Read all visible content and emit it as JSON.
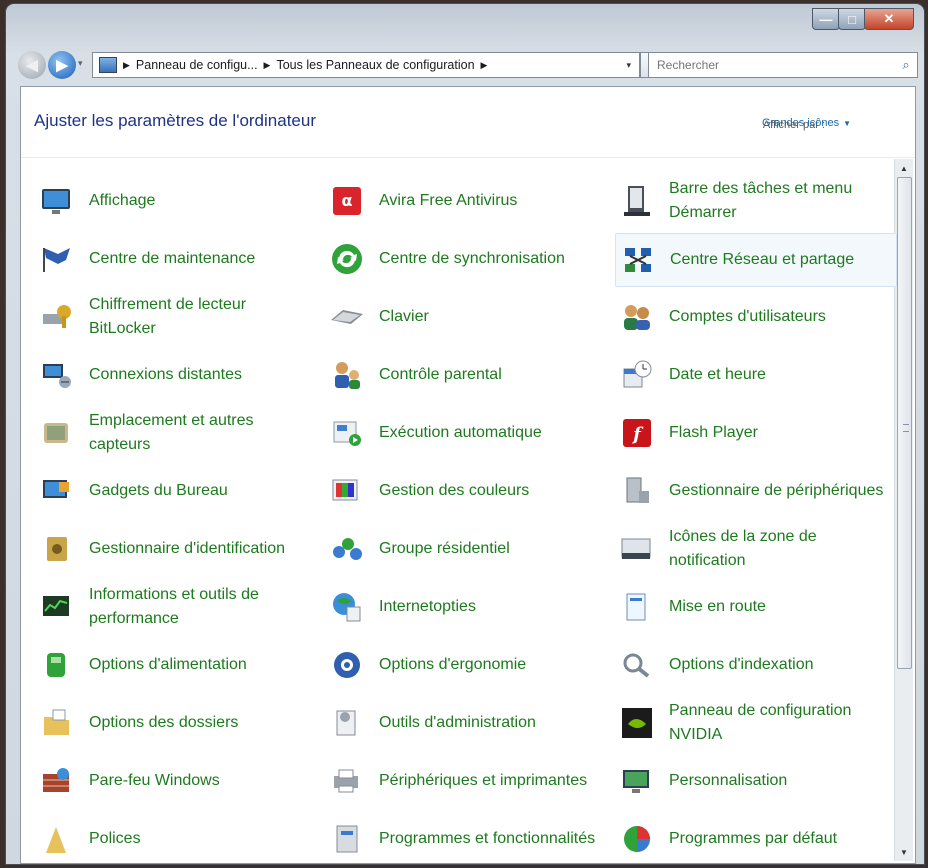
{
  "window": {
    "min_label": "—",
    "max_label": "□",
    "close_label": "✕"
  },
  "nav": {
    "back_glyph": "◀",
    "forward_glyph": "▶",
    "history_glyph": "▾",
    "breadcrumb": [
      "Panneau de configu...",
      "Tous les Panneaux de configuration"
    ],
    "breadcrumb_sep": "▶",
    "dropdown_glyph": "▾",
    "refresh_glyph": "↻",
    "search_placeholder": "Rechercher",
    "search_glyph": "⌕"
  },
  "header": {
    "title": "Ajuster les paramètres de l'ordinateur",
    "view_by_label": "Afficher par :",
    "view_by_value": "Grandes icônes",
    "view_caret": "▼"
  },
  "scroll": {
    "up": "▲",
    "down": "▼"
  },
  "items": [
    {
      "label": "Affichage",
      "icon": "display-icon"
    },
    {
      "label": "Avira Free Antivirus",
      "icon": "avira-icon"
    },
    {
      "label": "Barre des tâches et menu Démarrer",
      "icon": "taskbar-icon"
    },
    {
      "label": "Centre de maintenance",
      "icon": "flag-icon"
    },
    {
      "label": "Centre de synchronisation",
      "icon": "sync-icon"
    },
    {
      "label": "Centre Réseau et partage",
      "icon": "network-icon"
    },
    {
      "label": "Chiffrement de lecteur BitLocker",
      "icon": "bitlocker-icon"
    },
    {
      "label": "Clavier",
      "icon": "keyboard-icon"
    },
    {
      "label": "Comptes d'utilisateurs",
      "icon": "users-icon"
    },
    {
      "label": "Connexions distantes",
      "icon": "remote-icon"
    },
    {
      "label": "Contrôle parental",
      "icon": "parental-icon"
    },
    {
      "label": "Date et heure",
      "icon": "clock-icon"
    },
    {
      "label": "Emplacement et autres capteurs",
      "icon": "sensor-icon"
    },
    {
      "label": "Exécution automatique",
      "icon": "autoplay-icon"
    },
    {
      "label": "Flash Player",
      "icon": "flash-icon"
    },
    {
      "label": "Gadgets du Bureau",
      "icon": "gadgets-icon"
    },
    {
      "label": "Gestion des couleurs",
      "icon": "color-icon"
    },
    {
      "label": "Gestionnaire de périphériques",
      "icon": "device-manager-icon"
    },
    {
      "label": "Gestionnaire d'identification",
      "icon": "credential-icon"
    },
    {
      "label": "Groupe résidentiel",
      "icon": "homegroup-icon"
    },
    {
      "label": "Icônes de la zone de notification",
      "icon": "notification-icon"
    },
    {
      "label": "Informations et outils de performance",
      "icon": "performance-icon"
    },
    {
      "label": "Internetopties",
      "icon": "internet-icon"
    },
    {
      "label": "Mise en route",
      "icon": "getting-started-icon"
    },
    {
      "label": "Options d'alimentation",
      "icon": "power-icon"
    },
    {
      "label": "Options d'ergonomie",
      "icon": "ease-icon"
    },
    {
      "label": "Options d'indexation",
      "icon": "indexing-icon"
    },
    {
      "label": "Options des dossiers",
      "icon": "folder-icon"
    },
    {
      "label": "Outils d'administration",
      "icon": "admin-icon"
    },
    {
      "label": "Panneau de configuration NVIDIA",
      "icon": "nvidia-icon"
    },
    {
      "label": "Pare-feu Windows",
      "icon": "firewall-icon"
    },
    {
      "label": "Périphériques et imprimantes",
      "icon": "printer-icon"
    },
    {
      "label": "Personnalisation",
      "icon": "personalize-icon"
    },
    {
      "label": "Polices",
      "icon": "fonts-icon"
    },
    {
      "label": "Programmes et fonctionnalités",
      "icon": "programs-icon"
    },
    {
      "label": "Programmes par défaut",
      "icon": "default-programs-icon"
    }
  ],
  "highlighted_item": "Centre Réseau et partage",
  "colors": {
    "link_green": "#1e7a1e",
    "title_blue": "#1e3287"
  }
}
